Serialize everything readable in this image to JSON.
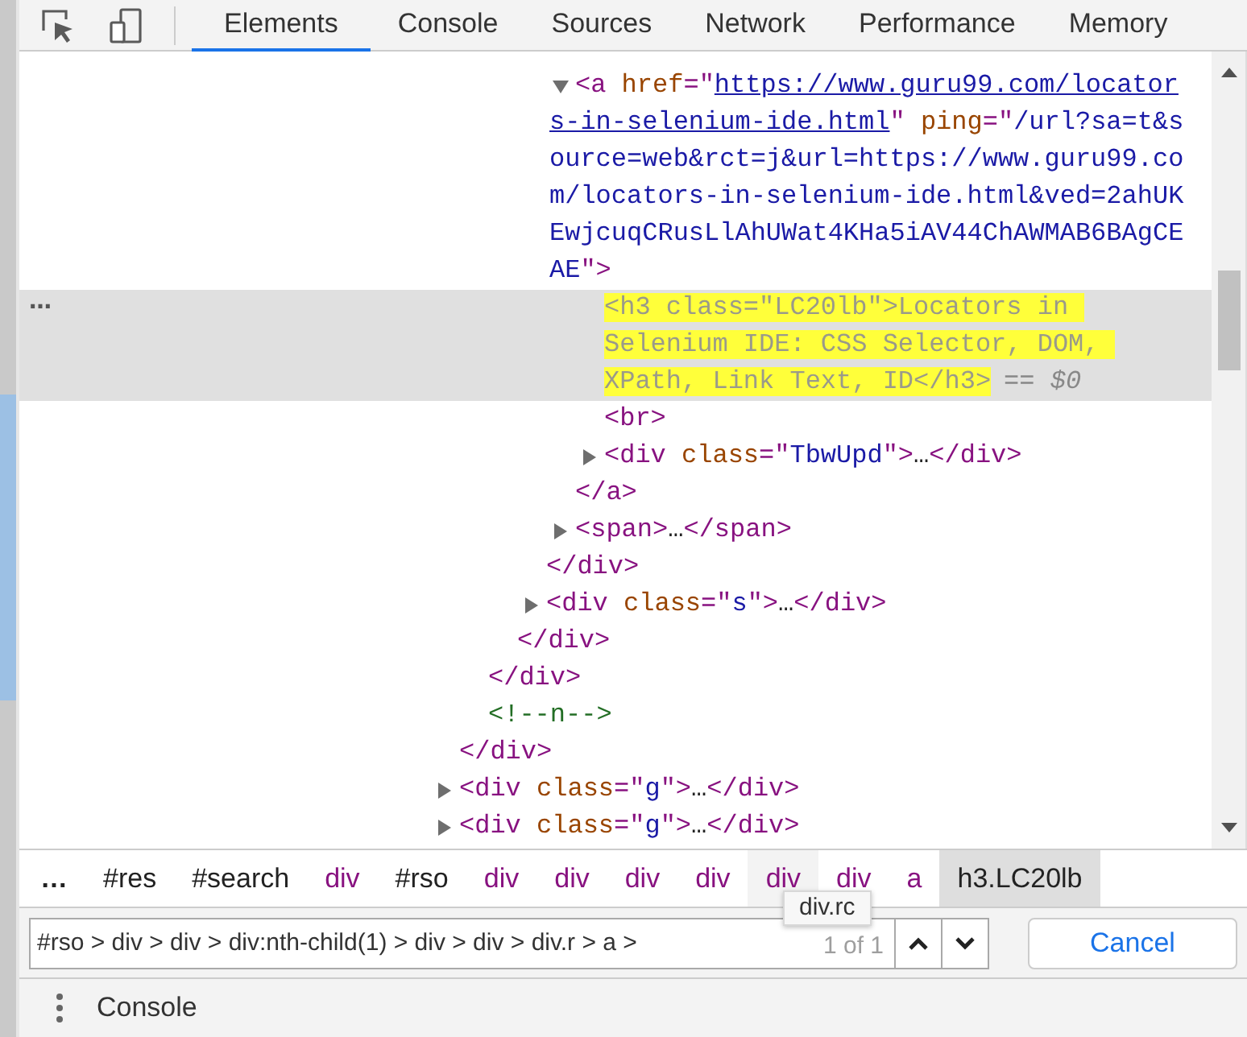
{
  "tabs": [
    {
      "label": "Elements",
      "selected": true
    },
    {
      "label": "Console",
      "selected": false
    },
    {
      "label": "Sources",
      "selected": false
    },
    {
      "label": "Network",
      "selected": false
    },
    {
      "label": "Performance",
      "selected": false
    },
    {
      "label": "Memory",
      "selected": false
    }
  ],
  "tree": [
    {
      "selected": false,
      "close": "</div>",
      "children": [
        {
          "selected": false,
          "close": "</div>",
          "children": [
            {
              "selected": false,
              "close": "</div>",
              "children": [
                {
                  "selected": false,
                  "close": "</div>",
                  "children": [
                    {
                      "selected": false,
                      "expanded": true,
                      "open": [
                        {
                          "kind": "tag",
                          "text": "<a"
                        },
                        {
                          "kind": "attr",
                          "text": " href"
                        },
                        {
                          "kind": "tag",
                          "text": "=\""
                        },
                        {
                          "kind": "link",
                          "text": "https://www.guru99.com/locators-in-selenium-ide.html"
                        },
                        {
                          "kind": "tag",
                          "text": "\""
                        },
                        {
                          "kind": "attr",
                          "text": " ping"
                        },
                        {
                          "kind": "tag",
                          "text": "=\""
                        },
                        {
                          "kind": "value",
                          "text": "/url?sa=t&source=web&rct=j&url=https://www.guru99.com/locators-in-selenium-ide.html&ved=2ahUKEwjcuqCRusLlAhUWat4KHa5iAV44ChAWMAB6BAgCEAE"
                        },
                        {
                          "kind": "tag",
                          "text": "\">"
                        }
                      ],
                      "close": "</a>",
                      "children": [
                        {
                          "selected": true,
                          "menu": "⋯",
                          "console_ref": "== $0",
                          "open": [
                            {
                              "kind": "match",
                              "text": "<h3 class=\"LC20lb\">Locators in Selenium IDE: CSS Selector, DOM, XPath, Link Text, ID</h3>"
                            }
                          ]
                        },
                        {
                          "selected": false,
                          "open": [
                            {
                              "kind": "tag",
                              "text": "<br>"
                            }
                          ]
                        },
                        {
                          "selected": false,
                          "expanded": false,
                          "open": [
                            {
                              "kind": "tag",
                              "text": "<div"
                            },
                            {
                              "kind": "attr",
                              "text": " class"
                            },
                            {
                              "kind": "tag",
                              "text": "=\""
                            },
                            {
                              "kind": "value",
                              "text": "TbwUpd"
                            },
                            {
                              "kind": "tag",
                              "text": "\">"
                            },
                            {
                              "kind": "text",
                              "text": "…"
                            },
                            {
                              "kind": "tag",
                              "text": "</div>"
                            }
                          ]
                        }
                      ]
                    },
                    {
                      "selected": false,
                      "expanded": false,
                      "open": [
                        {
                          "kind": "tag",
                          "text": "<span>"
                        },
                        {
                          "kind": "text",
                          "text": "…"
                        },
                        {
                          "kind": "tag",
                          "text": "</span>"
                        }
                      ]
                    }
                  ]
                },
                {
                  "selected": false,
                  "expanded": false,
                  "open": [
                    {
                      "kind": "tag",
                      "text": "<div"
                    },
                    {
                      "kind": "attr",
                      "text": " class"
                    },
                    {
                      "kind": "tag",
                      "text": "=\""
                    },
                    {
                      "kind": "value",
                      "text": "s"
                    },
                    {
                      "kind": "tag",
                      "text": "\">"
                    },
                    {
                      "kind": "text",
                      "text": "…"
                    },
                    {
                      "kind": "tag",
                      "text": "</div>"
                    }
                  ]
                }
              ]
            }
          ]
        },
        {
          "selected": false,
          "open": [
            {
              "kind": "comment",
              "text": "<!--n-->"
            }
          ]
        }
      ]
    },
    {
      "selected": false,
      "expanded": false,
      "open": [
        {
          "kind": "tag",
          "text": "<div"
        },
        {
          "kind": "attr",
          "text": " class"
        },
        {
          "kind": "tag",
          "text": "=\""
        },
        {
          "kind": "value",
          "text": "g"
        },
        {
          "kind": "tag",
          "text": "\">"
        },
        {
          "kind": "text",
          "text": "…"
        },
        {
          "kind": "tag",
          "text": "</div>"
        }
      ]
    },
    {
      "selected": false,
      "expanded": false,
      "open": [
        {
          "kind": "tag",
          "text": "<div"
        },
        {
          "kind": "attr",
          "text": " class"
        },
        {
          "kind": "tag",
          "text": "=\""
        },
        {
          "kind": "value",
          "text": "g"
        },
        {
          "kind": "tag",
          "text": "\">"
        },
        {
          "kind": "text",
          "text": "…"
        },
        {
          "kind": "tag",
          "text": "</div>"
        }
      ]
    }
  ],
  "breadcrumbs": [
    {
      "label": "…",
      "kind": "more",
      "selected": false,
      "hovered": false
    },
    {
      "label": "#res",
      "kind": "id",
      "selected": false,
      "hovered": false
    },
    {
      "label": "#search",
      "kind": "id",
      "selected": false,
      "hovered": false
    },
    {
      "label": "div",
      "kind": "tag",
      "selected": false,
      "hovered": false
    },
    {
      "label": "#rso",
      "kind": "id",
      "selected": false,
      "hovered": false
    },
    {
      "label": "div",
      "kind": "tag",
      "selected": false,
      "hovered": false
    },
    {
      "label": "div",
      "kind": "tag",
      "selected": false,
      "hovered": false
    },
    {
      "label": "div",
      "kind": "tag",
      "selected": false,
      "hovered": false
    },
    {
      "label": "div",
      "kind": "tag",
      "selected": false,
      "hovered": false
    },
    {
      "label": "div",
      "kind": "tag",
      "selected": false,
      "hovered": true
    },
    {
      "label": "div",
      "kind": "tag",
      "selected": false,
      "hovered": false
    },
    {
      "label": "a",
      "kind": "tag",
      "selected": false,
      "hovered": false
    },
    {
      "label": "h3.LC20lb",
      "kind": "class",
      "selected": true,
      "hovered": false
    }
  ],
  "tooltip": "div.rc",
  "search": {
    "value": "#rso > div > div > div:nth-child(1) > div > div > div.r > a >",
    "count": "1 of 1"
  },
  "cancel_button": "Cancel",
  "drawer": {
    "tab": "Console"
  }
}
